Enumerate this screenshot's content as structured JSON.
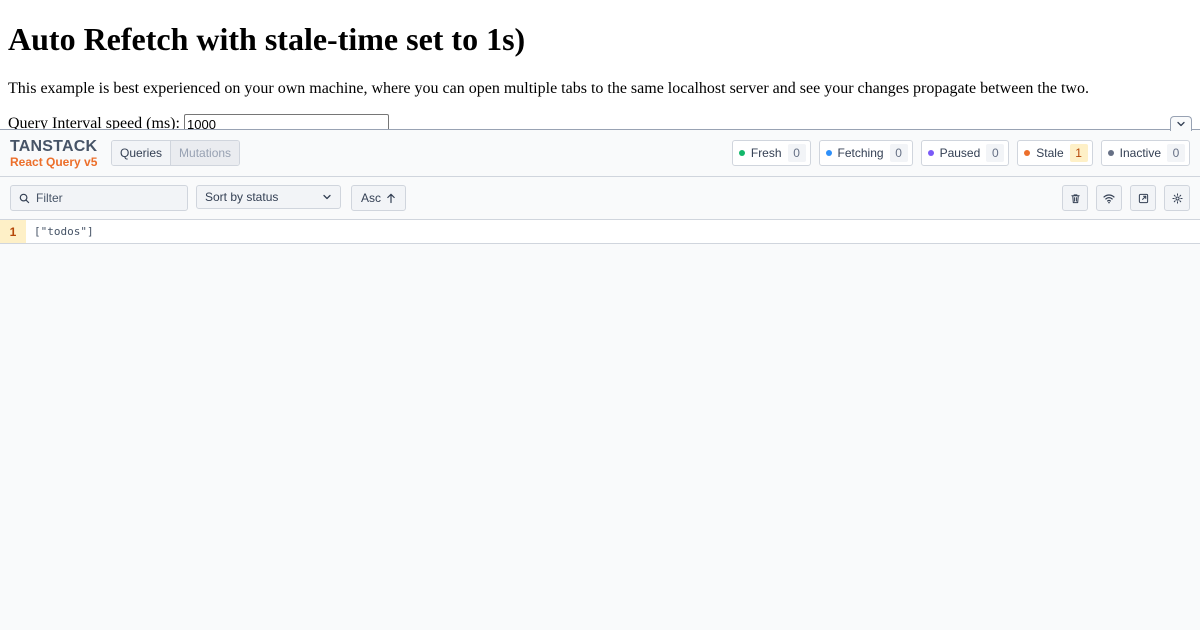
{
  "page": {
    "title": "Auto Refetch with stale-time set to 1s)",
    "description": "This example is best experienced on your own machine, where you can open multiple tabs to the same localhost server and see your changes propagate between the two.",
    "interval_label": "Query Interval speed (ms):",
    "interval_value": "1000"
  },
  "devtools": {
    "logo_main": "TANSTACK",
    "logo_sub": "React Query v5",
    "tabs": [
      {
        "label": "Queries",
        "active": true
      },
      {
        "label": "Mutations",
        "active": false
      }
    ],
    "statuses": [
      {
        "label": "Fresh",
        "count": "0",
        "color": "#12b76a"
      },
      {
        "label": "Fetching",
        "count": "0",
        "color": "#2e90fa"
      },
      {
        "label": "Paused",
        "count": "0",
        "color": "#7a5af8"
      },
      {
        "label": "Stale",
        "count": "1",
        "color": "#ec6f2b"
      },
      {
        "label": "Inactive",
        "count": "0",
        "color": "#667085"
      }
    ],
    "filter_placeholder": "Filter",
    "sort_label": "Sort by status",
    "order_label": "Asc",
    "queries": [
      {
        "observers": "1",
        "key": "[\"todos\"]"
      }
    ]
  }
}
